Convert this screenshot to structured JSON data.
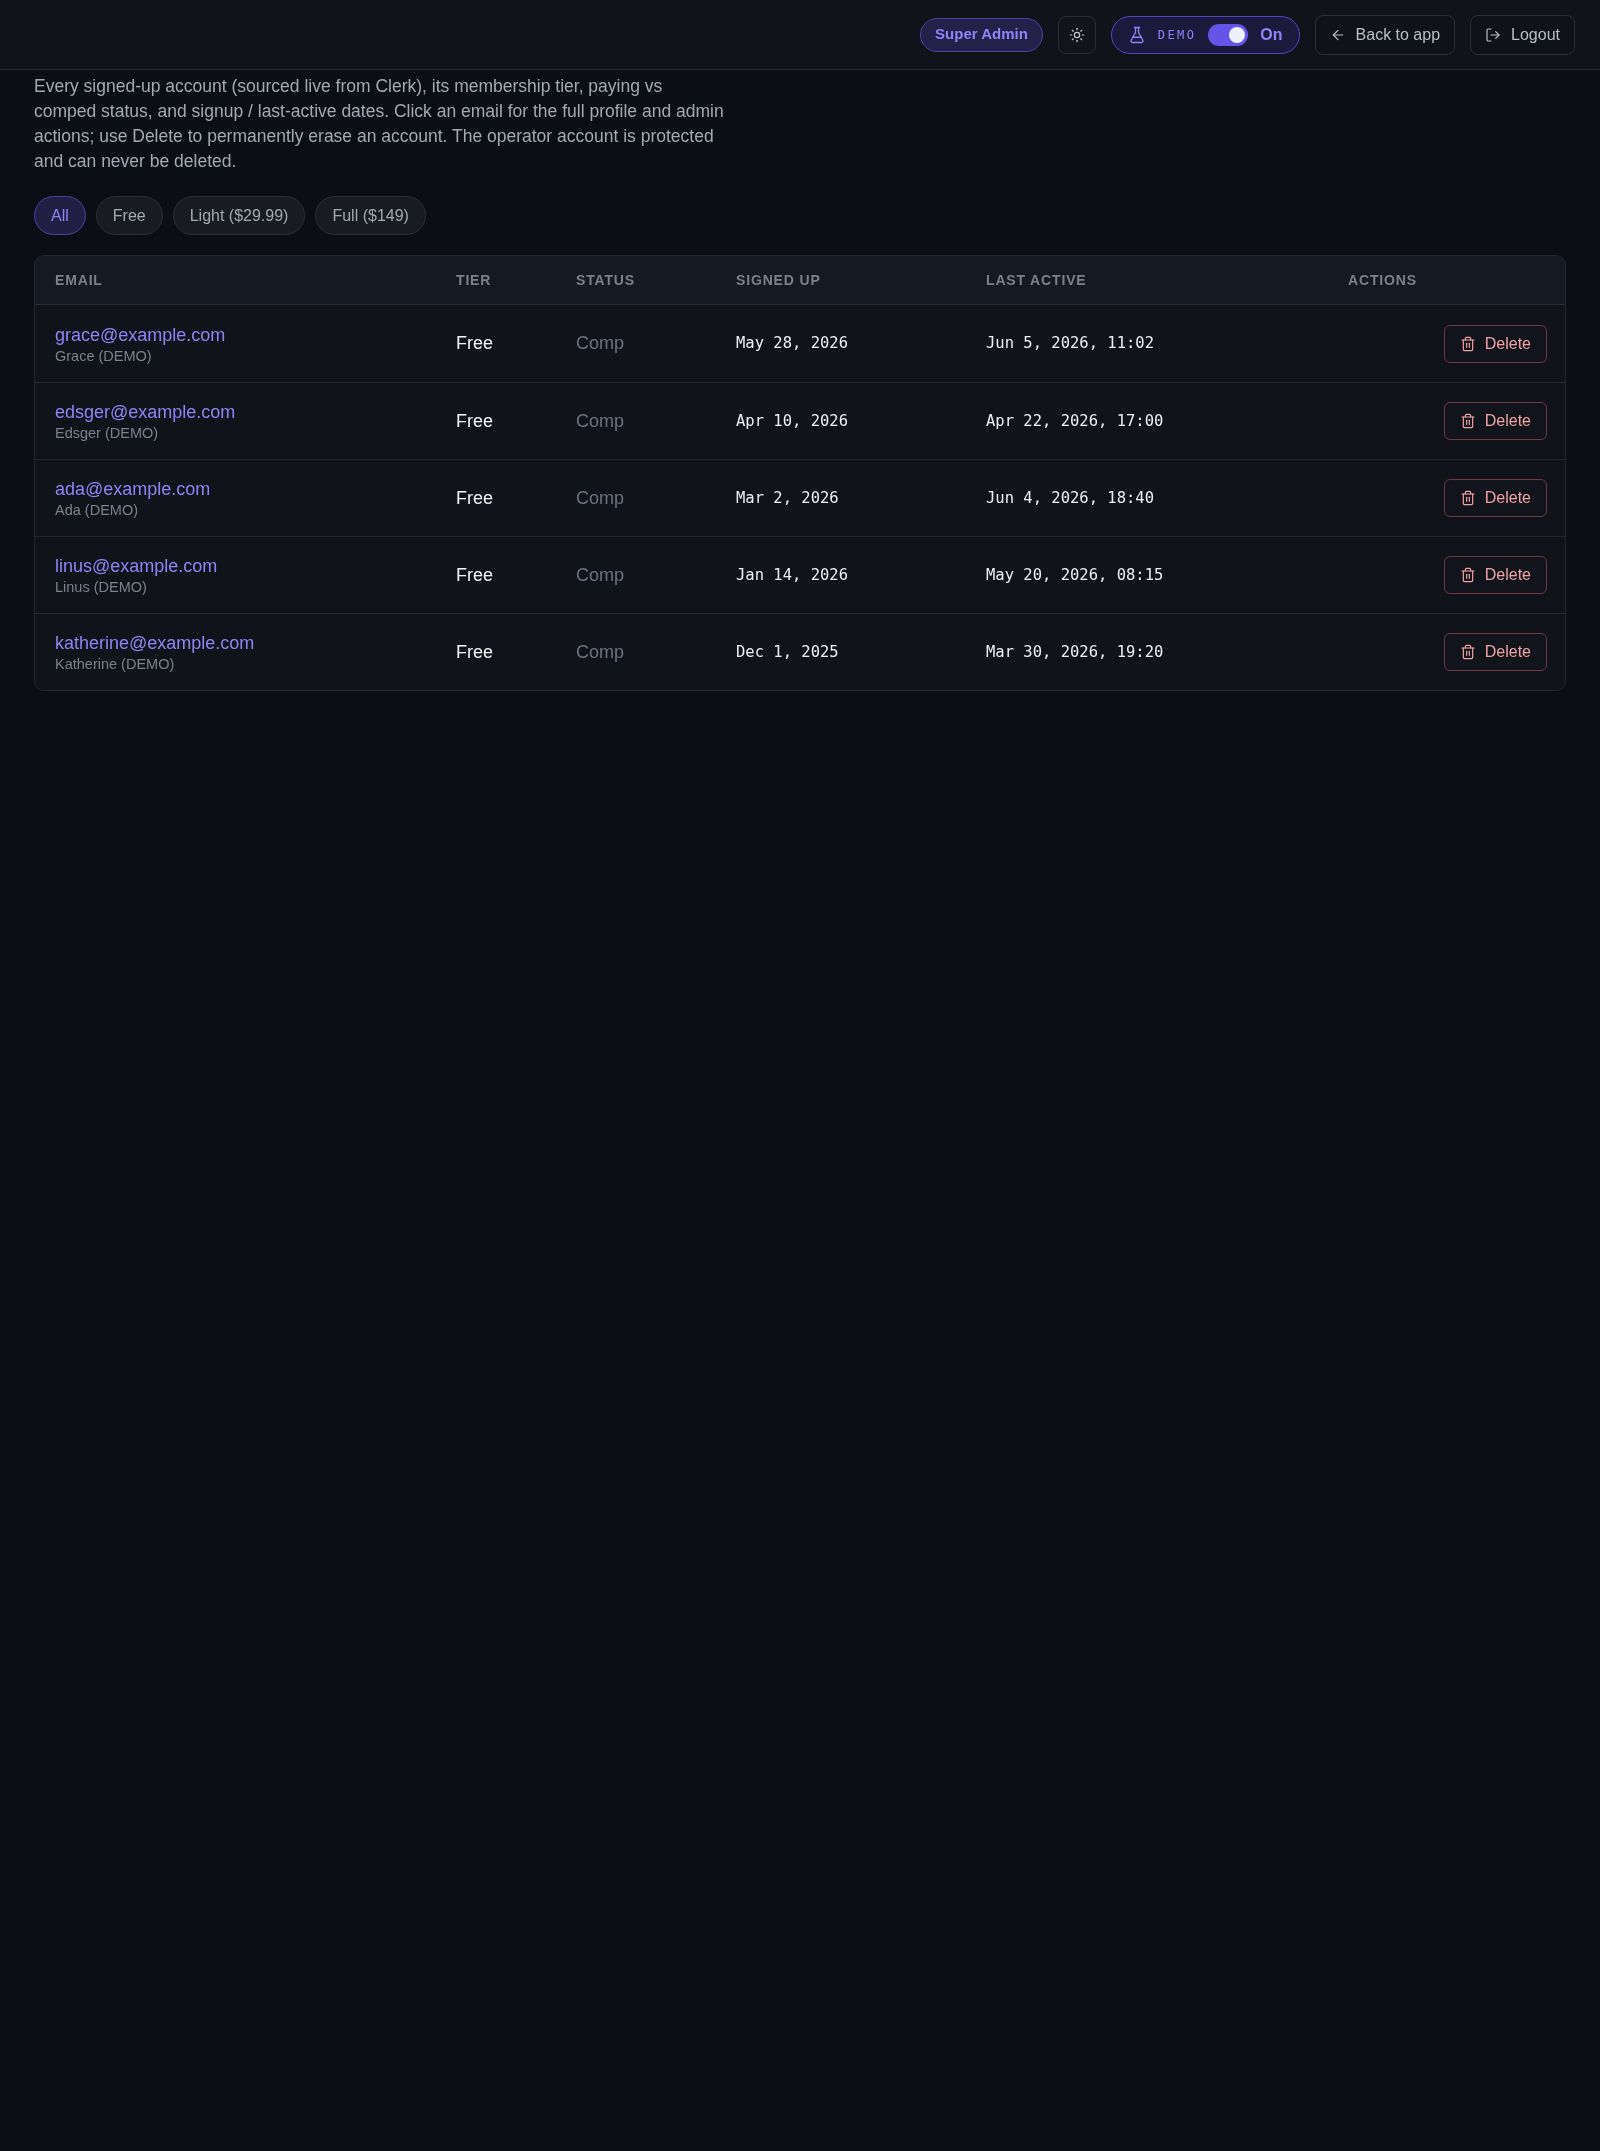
{
  "header": {
    "badge": "Super Admin",
    "demo_toggle": {
      "label": "DEMO",
      "on": true,
      "state_text": "On"
    },
    "buttons": [
      {
        "kind": "back",
        "label": "Back to app"
      },
      {
        "kind": "logout",
        "label": "Logout"
      }
    ]
  },
  "description": "Every signed-up account (sourced live from Clerk), its membership tier, paying vs comped status, and signup / last-active dates. Click an email for the full profile and admin actions; use Delete to permanently erase an account. The operator account is protected and can never be deleted.",
  "filters": [
    {
      "label": "All",
      "selected": true
    },
    {
      "label": "Free",
      "selected": false
    },
    {
      "label": "Light ($29.99)",
      "selected": false
    },
    {
      "label": "Full ($149)",
      "selected": false
    }
  ],
  "table": {
    "columns": [
      "EMAIL",
      "TIER",
      "STATUS",
      "SIGNED UP",
      "LAST ACTIVE",
      "ACTIONS"
    ],
    "rows": [
      {
        "email": "grace@example.com",
        "name": "Grace (DEMO)",
        "tier": "Free",
        "status": "Comp",
        "signed_up": "May 28, 2026",
        "last_active": "Jun 5, 2026, 11:02",
        "action": "Delete"
      },
      {
        "email": "edsger@example.com",
        "name": "Edsger (DEMO)",
        "tier": "Free",
        "status": "Comp",
        "signed_up": "Apr 10, 2026",
        "last_active": "Apr 22, 2026, 17:00",
        "action": "Delete"
      },
      {
        "email": "ada@example.com",
        "name": "Ada (DEMO)",
        "tier": "Free",
        "status": "Comp",
        "signed_up": "Mar 2, 2026",
        "last_active": "Jun 4, 2026, 18:40",
        "action": "Delete"
      },
      {
        "email": "linus@example.com",
        "name": "Linus (DEMO)",
        "tier": "Free",
        "status": "Comp",
        "signed_up": "Jan 14, 2026",
        "last_active": "May 20, 2026, 08:15",
        "action": "Delete"
      },
      {
        "email": "katherine@example.com",
        "name": "Katherine (DEMO)",
        "tier": "Free",
        "status": "Comp",
        "signed_up": "Dec 1, 2025",
        "last_active": "Mar 30, 2026, 19:20",
        "action": "Delete"
      }
    ]
  }
}
